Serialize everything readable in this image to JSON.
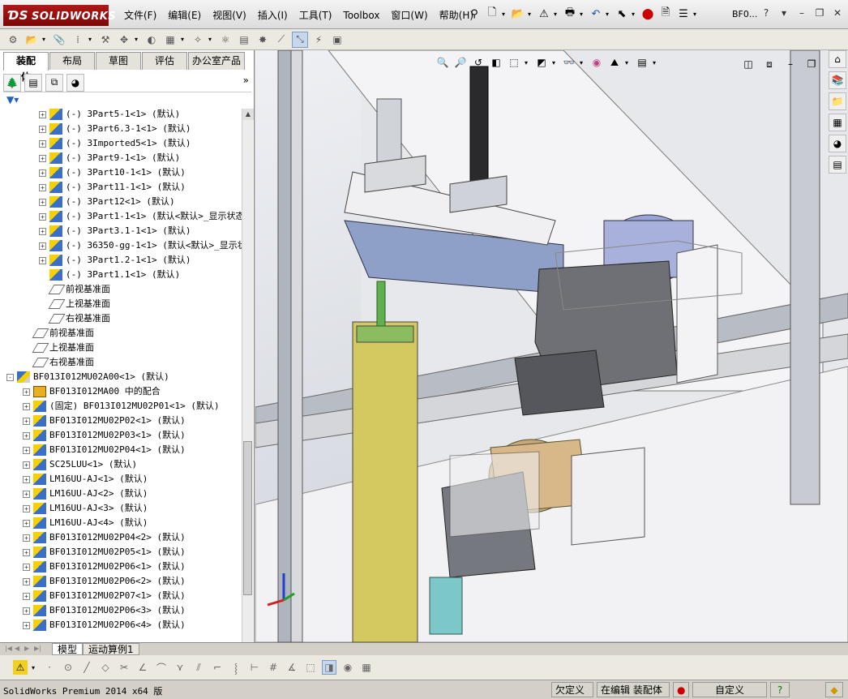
{
  "app": {
    "logo": "SOLIDWORKS",
    "doc_title": "BF0...",
    "help": "?"
  },
  "menu": [
    "文件(F)",
    "编辑(E)",
    "视图(V)",
    "插入(I)",
    "工具(T)",
    "Toolbox",
    "窗口(W)",
    "帮助(H)"
  ],
  "tabs": [
    "装配体",
    "布局",
    "草图",
    "评估",
    "办公室产品"
  ],
  "tree": [
    {
      "level": 2,
      "exp": "+",
      "icon": "part",
      "label": "(-) 3Part5-1<1> (默认)"
    },
    {
      "level": 2,
      "exp": "+",
      "icon": "part",
      "label": "(-) 3Part6.3-1<1> (默认)"
    },
    {
      "level": 2,
      "exp": "+",
      "icon": "part",
      "label": "(-) 3Imported5<1> (默认)"
    },
    {
      "level": 2,
      "exp": "+",
      "icon": "part",
      "label": "(-) 3Part9-1<1> (默认)"
    },
    {
      "level": 2,
      "exp": "+",
      "icon": "part",
      "label": "(-) 3Part10-1<1> (默认)"
    },
    {
      "level": 2,
      "exp": "+",
      "icon": "part",
      "label": "(-) 3Part11-1<1> (默认)"
    },
    {
      "level": 2,
      "exp": "+",
      "icon": "part",
      "label": "(-) 3Part12<1> (默认)"
    },
    {
      "level": 2,
      "exp": "+",
      "icon": "part",
      "label": "(-) 3Part1-1<1> (默认<默认>_显示状态"
    },
    {
      "level": 2,
      "exp": "+",
      "icon": "part",
      "label": "(-) 3Part3.1-1<1> (默认)"
    },
    {
      "level": 2,
      "exp": "+",
      "icon": "part",
      "label": "(-) 36350-gg-1<1> (默认<默认>_显示状"
    },
    {
      "level": 2,
      "exp": "+",
      "icon": "part",
      "label": "(-) 3Part1.2-1<1> (默认)"
    },
    {
      "level": 2,
      "exp": "",
      "icon": "part",
      "label": "(-) 3Part1.1<1> (默认)"
    },
    {
      "level": 2,
      "exp": "",
      "icon": "plane",
      "label": "前视基准面"
    },
    {
      "level": 2,
      "exp": "",
      "icon": "plane",
      "label": "上视基准面"
    },
    {
      "level": 2,
      "exp": "",
      "icon": "plane",
      "label": "右视基准面"
    },
    {
      "level": 1,
      "exp": "",
      "icon": "plane",
      "label": "前视基准面"
    },
    {
      "level": 1,
      "exp": "",
      "icon": "plane",
      "label": "上视基准面"
    },
    {
      "level": 1,
      "exp": "",
      "icon": "plane",
      "label": "右视基准面"
    },
    {
      "level": 0,
      "exp": "-",
      "icon": "asm",
      "label": "BF013I012MU02A00<1> (默认)"
    },
    {
      "level": 1,
      "exp": "+",
      "icon": "mate",
      "label": "BF013I012MA00 中的配合"
    },
    {
      "level": 1,
      "exp": "+",
      "icon": "part",
      "label": "(固定) BF013I012MU02P01<1> (默认)"
    },
    {
      "level": 1,
      "exp": "+",
      "icon": "part",
      "label": "BF013I012MU02P02<1> (默认)"
    },
    {
      "level": 1,
      "exp": "+",
      "icon": "part",
      "label": "BF013I012MU02P03<1> (默认)"
    },
    {
      "level": 1,
      "exp": "+",
      "icon": "part",
      "label": "BF013I012MU02P04<1> (默认)"
    },
    {
      "level": 1,
      "exp": "+",
      "icon": "part",
      "label": "SC25LUU<1> (默认)"
    },
    {
      "level": 1,
      "exp": "+",
      "icon": "part",
      "label": "LM16UU-AJ<1> (默认)"
    },
    {
      "level": 1,
      "exp": "+",
      "icon": "part",
      "label": "LM16UU-AJ<2> (默认)"
    },
    {
      "level": 1,
      "exp": "+",
      "icon": "part",
      "label": "LM16UU-AJ<3> (默认)"
    },
    {
      "level": 1,
      "exp": "+",
      "icon": "part",
      "label": "LM16UU-AJ<4> (默认)"
    },
    {
      "level": 1,
      "exp": "+",
      "icon": "part",
      "label": "BF013I012MU02P04<2> (默认)"
    },
    {
      "level": 1,
      "exp": "+",
      "icon": "part",
      "label": "BF013I012MU02P05<1> (默认)"
    },
    {
      "level": 1,
      "exp": "+",
      "icon": "part",
      "label": "BF013I012MU02P06<1> (默认)"
    },
    {
      "level": 1,
      "exp": "+",
      "icon": "part",
      "label": "BF013I012MU02P06<2> (默认)"
    },
    {
      "level": 1,
      "exp": "+",
      "icon": "part",
      "label": "BF013I012MU02P07<1> (默认)"
    },
    {
      "level": 1,
      "exp": "+",
      "icon": "part",
      "label": "BF013I012MU02P06<3> (默认)"
    },
    {
      "level": 1,
      "exp": "+",
      "icon": "part",
      "label": "BF013I012MU02P06<4> (默认)"
    }
  ],
  "bottom_tabs": [
    "模型",
    "运动算例1"
  ],
  "status": {
    "left": "SolidWorks Premium 2014 x64 版",
    "defined": "欠定义",
    "editing": "在编辑 装配体",
    "custom": "自定义"
  },
  "colors": {
    "accent": "#b01818",
    "selection": "#c8d8ec"
  }
}
